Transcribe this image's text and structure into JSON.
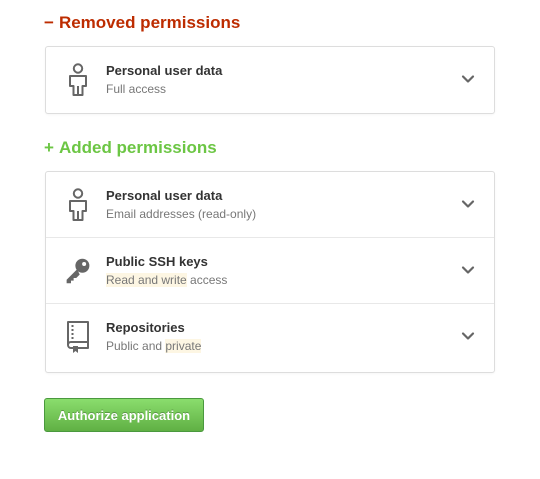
{
  "removed": {
    "sign": "−",
    "title": "Removed permissions",
    "color": "#bd2c00",
    "items": [
      {
        "title": "Personal user data",
        "desc": "Full access",
        "icon": "person-icon"
      }
    ]
  },
  "added": {
    "sign": "+",
    "title": "Added permissions",
    "color": "#6cc644",
    "items": [
      {
        "title": "Personal user data",
        "desc": "Email addresses (read-only)",
        "icon": "person-icon"
      },
      {
        "title": "Public SSH keys",
        "desc_highlight": "Read and write",
        "desc_rest": " access",
        "icon": "key-icon"
      },
      {
        "title": "Repositories",
        "desc_prefix": "Public and ",
        "desc_highlight": "private",
        "icon": "repo-icon"
      }
    ]
  },
  "authorize_label": "Authorize application",
  "accent": "#60b044"
}
